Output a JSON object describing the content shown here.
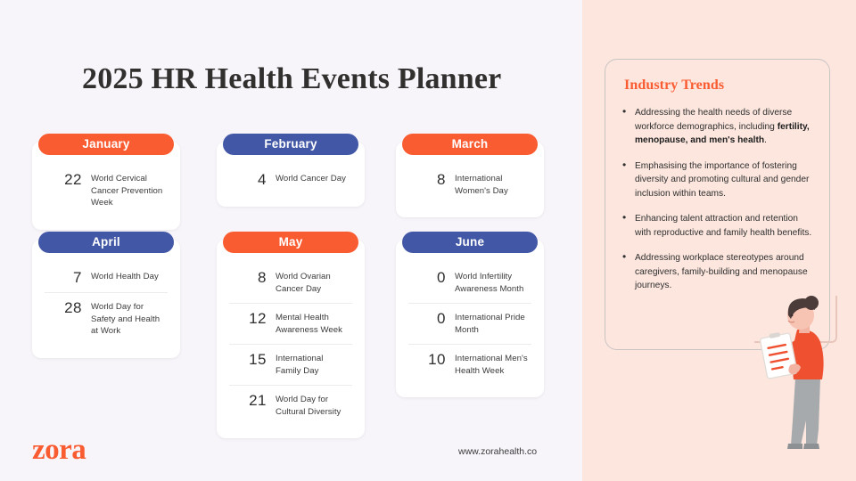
{
  "page": {
    "title": "2025 HR Health Events Planner",
    "left_bg": "#f7f5f9",
    "right_bg": "#fce6de",
    "accent_orange": "#fa5c32",
    "accent_blue": "#4257a5"
  },
  "months": [
    {
      "name": "January",
      "color": "orange",
      "events": [
        {
          "day": "22",
          "label": "World Cervical Cancer Prevention Week"
        }
      ]
    },
    {
      "name": "February",
      "color": "blue",
      "events": [
        {
          "day": "4",
          "label": "World Cancer Day"
        }
      ]
    },
    {
      "name": "March",
      "color": "orange",
      "events": [
        {
          "day": "8",
          "label": "International Women's Day"
        }
      ]
    },
    {
      "name": "April",
      "color": "blue",
      "events": [
        {
          "day": "7",
          "label": "World Health Day"
        },
        {
          "day": "28",
          "label": "World Day for Safety and Health at Work"
        }
      ]
    },
    {
      "name": "May",
      "color": "orange",
      "events": [
        {
          "day": "8",
          "label": "World Ovarian Cancer Day"
        },
        {
          "day": "12",
          "label": "Mental Health Awareness Week"
        },
        {
          "day": "15",
          "label": "International Family Day"
        },
        {
          "day": "21",
          "label": "World Day for Cultural Diversity"
        }
      ]
    },
    {
      "name": "June",
      "color": "blue",
      "events": [
        {
          "day": "0",
          "label": "World Infertility Awareness Month"
        },
        {
          "day": "0",
          "label": "International Pride Month"
        },
        {
          "day": "10",
          "label": "International Men's Health Week"
        }
      ]
    }
  ],
  "trends": {
    "heading": "Industry Trends",
    "bullets": [
      {
        "text": "Addressing the health needs of diverse workforce demographics, including ",
        "bold": "fertility, menopause, and men's health",
        "tail": "."
      },
      {
        "text": "Emphasising the importance of fostering diversity and promoting cultural and gender inclusion within teams.",
        "bold": "",
        "tail": ""
      },
      {
        "text": "Enhancing talent attraction and retention with reproductive and family health benefits.",
        "bold": "",
        "tail": ""
      },
      {
        "text": "Addressing workplace stereotypes around caregivers, family-building and menopause journeys.",
        "bold": "",
        "tail": ""
      }
    ]
  },
  "footer": {
    "logo": "zora",
    "url": "www.zorahealth.co"
  },
  "illustration": {
    "name": "woman-holding-clipboard",
    "top_color": "#ef5130",
    "trousers_color": "#a7aaad",
    "skin_color": "#f7c4b4",
    "hair_color": "#4b3c3a"
  }
}
